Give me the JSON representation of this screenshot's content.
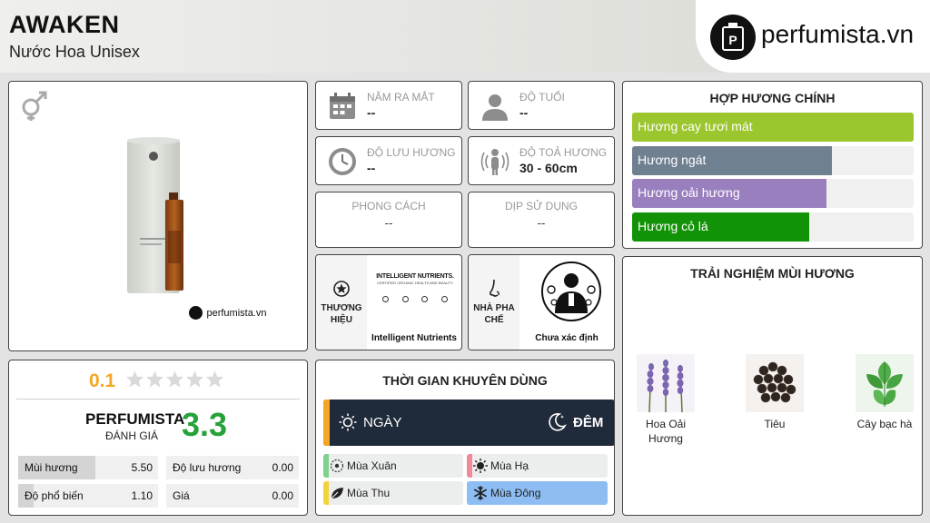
{
  "header": {
    "title": "AWAKEN",
    "subtitle": "Nước Hoa Unisex",
    "logo_text": "perfumista.vn"
  },
  "product": {
    "watermark": "perfumista.vn",
    "gender_icon": "unisex-symbol-icon"
  },
  "info": {
    "release_year": {
      "label": "NĂM RA MẮT",
      "value": "--"
    },
    "age": {
      "label": "ĐỘ TUỔI",
      "value": "--"
    },
    "longevity": {
      "label": "ĐỘ LƯU HƯƠNG",
      "value": "--"
    },
    "sillage": {
      "label": "ĐỘ TOẢ HƯƠNG",
      "value": "30 - 60cm"
    },
    "style": {
      "label": "PHONG CÁCH",
      "value": "--"
    },
    "occasion": {
      "label": "DỊP SỬ DỤNG",
      "value": "--"
    }
  },
  "brand": {
    "label_line1": "THƯƠNG",
    "label_line2": "HIỆU",
    "logo_title": "INTELLIGENT NUTRIENTS.",
    "logo_tagline": "CERTIFIED ORGANIC HEALTH AND BEAUTY",
    "name": "Intelligent Nutrients"
  },
  "perfumer": {
    "label_line1": "NHÀ PHA",
    "label_line2": "CHẾ",
    "name": "Chưa xác định"
  },
  "accords": {
    "title": "HỢP HƯƠNG CHÍNH",
    "items": [
      {
        "label": "Hương cay tươi mát",
        "percent": 100,
        "color": "#9bc62d"
      },
      {
        "label": "Hương ngát",
        "percent": 71,
        "color": "#6f8091"
      },
      {
        "label": "Hương oải hương",
        "percent": 69,
        "color": "#9a7fbf"
      },
      {
        "label": "Hương cỏ lá",
        "percent": 63,
        "color": "#129307"
      }
    ]
  },
  "notes": {
    "title": "TRẢI NGHIỆM MÙI HƯƠNG",
    "items": [
      {
        "line1": "Hoa Oải",
        "line2": "Hương"
      },
      {
        "line1": "Tiêu",
        "line2": ""
      },
      {
        "line1": "Cây bạc hà",
        "line2": ""
      }
    ]
  },
  "rating": {
    "user_score": "0.1",
    "stars_filled": 0,
    "perfumista_label": "PERFUMISTA",
    "perfumista_sub": "ĐÁNH GIÁ",
    "perfumista_score": "3.3",
    "stats": [
      {
        "label": "Mùi hương",
        "value": "5.50",
        "percent": 55
      },
      {
        "label": "Độ lưu hương",
        "value": "0.00",
        "percent": 0
      },
      {
        "label": "Độ phổ biến",
        "value": "1.10",
        "percent": 11
      },
      {
        "label": "Giá",
        "value": "0.00",
        "percent": 0
      }
    ]
  },
  "time": {
    "title": "THỜI GIAN KHUYÊN DÙNG",
    "day": "NGÀY",
    "night": "ĐÊM",
    "seasons": [
      {
        "label": "Mùa Xuân",
        "color": "#7fd18b",
        "active": false
      },
      {
        "label": "Mùa Hạ",
        "color": "#f08a9a",
        "active": false
      },
      {
        "label": "Mùa Thu",
        "color": "#f2d33a",
        "active": false
      },
      {
        "label": "Mùa Đông",
        "color": "#8dbdf2",
        "active": true
      }
    ]
  },
  "colors": {
    "accent_green": "#26a23a",
    "score_orange": "#f5a623",
    "dark_navy": "#1f2a3a"
  }
}
